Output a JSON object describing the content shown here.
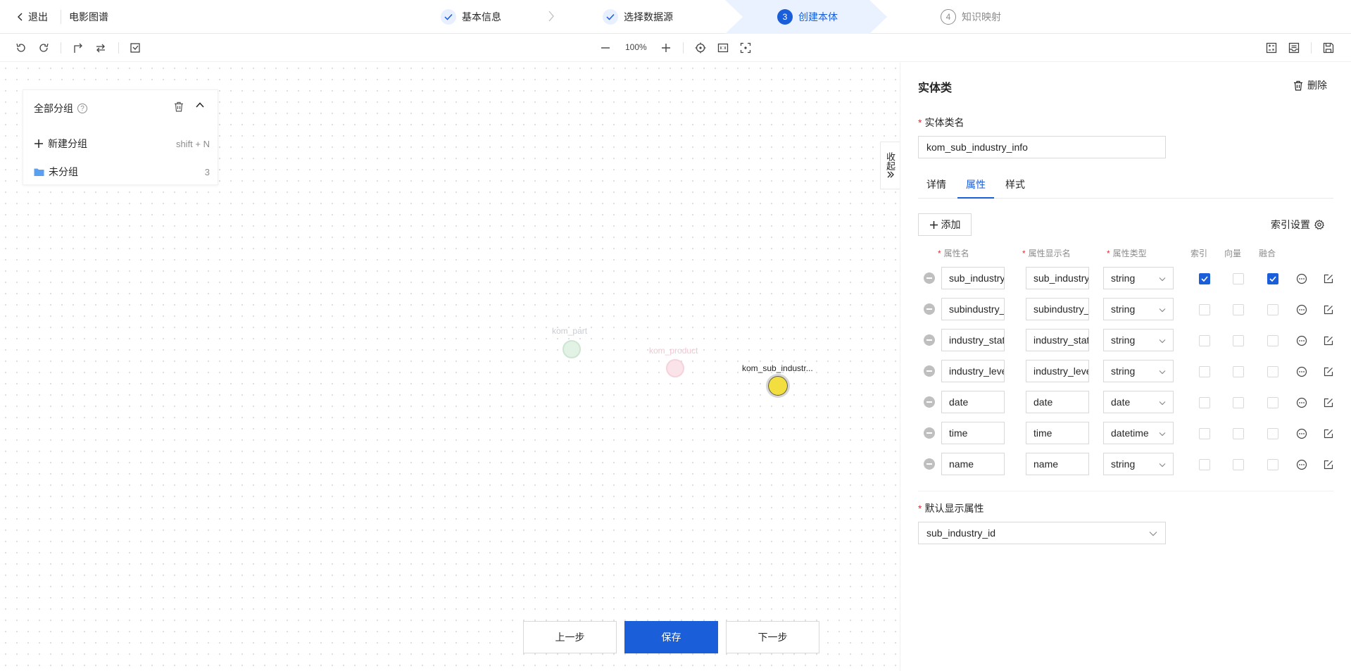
{
  "header": {
    "back_label": "退出",
    "project_title": "电影图谱",
    "steps": [
      {
        "number": "1",
        "label": "基本信息",
        "state": "done"
      },
      {
        "number": "2",
        "label": "选择数据源",
        "state": "done"
      },
      {
        "number": "3",
        "label": "创建本体",
        "state": "active"
      },
      {
        "number": "4",
        "label": "知识映射",
        "state": "todo"
      }
    ]
  },
  "toolbar": {
    "zoom": "100%"
  },
  "group_panel": {
    "title": "全部分组",
    "new_group_label": "新建分组",
    "new_group_shortcut": "shift + N",
    "ungrouped_label": "未分组",
    "ungrouped_count": "3"
  },
  "graph": {
    "nodes": [
      {
        "label": "kom_part",
        "color": "#d4ecd8"
      },
      {
        "label": "kom_product",
        "color": "#fadce3"
      },
      {
        "label": "kom_sub_industr...",
        "color": "#f2de3e"
      }
    ]
  },
  "collapse_tab": {
    "label": "收起"
  },
  "footer": {
    "prev_label": "上一步",
    "save_label": "保存",
    "next_label": "下一步"
  },
  "panel": {
    "title": "实体类",
    "delete_label": "删除",
    "name_label": "实体类名",
    "name_value": "kom_sub_industry_info",
    "tabs": [
      "详情",
      "属性",
      "样式"
    ],
    "active_tab": "属性",
    "add_label": "添加",
    "index_settings_label": "索引设置",
    "columns": {
      "attr_name": "属性名",
      "display_name": "属性显示名",
      "attr_type": "属性类型",
      "index": "索引",
      "vector": "向量",
      "merge": "融合"
    },
    "attributes": [
      {
        "name": "sub_industry_",
        "display": "sub_industry_",
        "type": "string",
        "index": true,
        "vector": false,
        "merge": true
      },
      {
        "name": "subindustry_n",
        "display": "subindustry_n",
        "type": "string",
        "index": false,
        "vector": false,
        "merge": false
      },
      {
        "name": "industry_statu",
        "display": "industry_statu",
        "type": "string",
        "index": false,
        "vector": false,
        "merge": false
      },
      {
        "name": "industry_level",
        "display": "industry_level",
        "type": "string",
        "index": false,
        "vector": false,
        "merge": false
      },
      {
        "name": "date",
        "display": "date",
        "type": "date",
        "index": false,
        "vector": false,
        "merge": false
      },
      {
        "name": "time",
        "display": "time",
        "type": "datetime",
        "index": false,
        "vector": false,
        "merge": false
      },
      {
        "name": "name",
        "display": "name",
        "type": "string",
        "index": false,
        "vector": false,
        "merge": false
      }
    ],
    "default_display_label": "默认显示属性",
    "default_display_value": "sub_industry_id"
  },
  "colors": {
    "primary": "#1a5fd9",
    "active_step_bg": "#eaf1ff"
  }
}
